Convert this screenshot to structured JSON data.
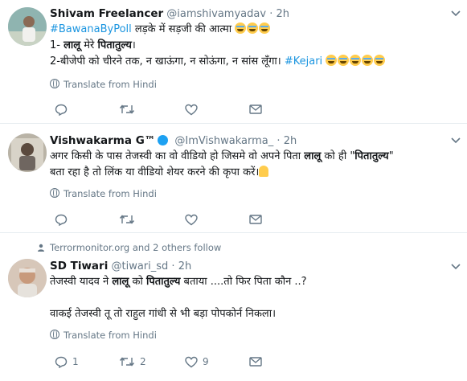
{
  "tweets": [
    {
      "name": "Shivam Freelancer",
      "handle": "@iamshivamyadav",
      "time": "2h",
      "line1_hashtag": "#BawanaByPoll",
      "line1_text": " लड़के में सड़जी की आत्मा ",
      "line2_a": "1- ",
      "line2_b": "लालू",
      "line2_c": " मेरे ",
      "line2_d": "पितातुल्य",
      "line2_e": "।",
      "line3_text": "2-बीजेपी को चीरने तक, न खाऊंगा, न सोऊंगा, न सांस लूँगा। ",
      "line3_hashtag": "#Kejari",
      "translate": "Translate from Hindi",
      "replies": "",
      "retweets": "",
      "likes": ""
    },
    {
      "name": "Vishwakarma G™",
      "handle": "@ImVishwakarma_",
      "time": "2h",
      "line1_a": "अगर किसी के पास तेजस्वी का वो वीडियो हो जिसमे वो अपने पिता ",
      "line1_b": "लालू",
      "line1_c": " को ही  \"",
      "line1_d": "पितातुल्य",
      "line1_e": "\"",
      "line2_text": "बता रहा है तो लिंक या वीडियो शेयर करने की कृपा करें।",
      "translate": "Translate from Hindi",
      "replies": "",
      "retweets": "",
      "likes": ""
    },
    {
      "social_context": "Terrormonitor.org and 2 others follow",
      "name": "SD Tiwari",
      "handle": "@tiwari_sd",
      "time": "2h",
      "line1_a": "तेजस्वी यादव ने ",
      "line1_b": "लालू",
      "line1_c": " को ",
      "line1_d": "पितातुल्य",
      "line1_e": " बताया ....तो फिर पिता कौन ..?",
      "line2_text": "वाकई तेजस्वी तू तो राहुल गांधी से भी बड़ा  पोपकोर्न निकला।",
      "translate": "Translate from Hindi",
      "replies": "1",
      "retweets": "2",
      "likes": "9"
    }
  ],
  "separator_dot": "·",
  "colors": {
    "link": "#1b95e0",
    "muted": "#657786",
    "divider": "#e6ecf0",
    "verified": "#1da1f2"
  },
  "icons": [
    "reply-icon",
    "retweet-icon",
    "like-icon",
    "message-icon",
    "globe-icon",
    "chevron-down-icon",
    "verified-badge-icon",
    "person-follow-icon"
  ]
}
